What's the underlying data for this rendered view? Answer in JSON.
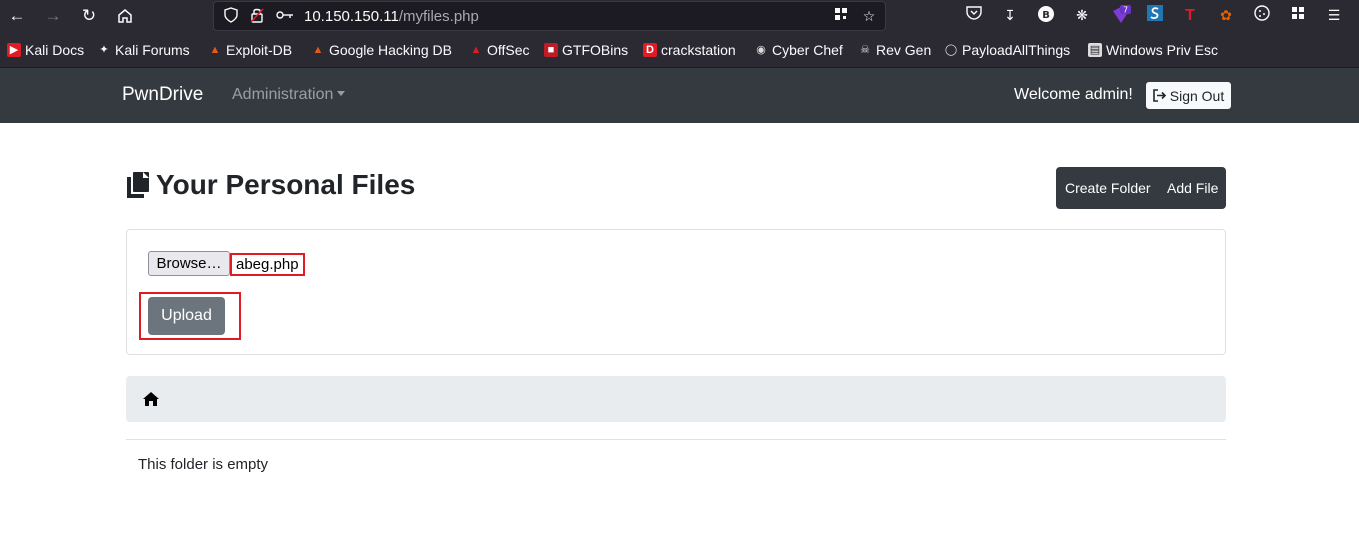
{
  "browser": {
    "url_host": "10.150.150.11",
    "url_path": "/myfiles.php",
    "extension_badge": "7"
  },
  "bookmarks": [
    {
      "label": "Kali Docs",
      "icon": "kali-docs-icon",
      "color": "#e01b24"
    },
    {
      "label": "Kali Forums",
      "icon": "kali-forums-icon",
      "color": "#ffffff"
    },
    {
      "label": "Exploit-DB",
      "icon": "exploit-db-icon",
      "color": "#e05a1b"
    },
    {
      "label": "Google Hacking DB",
      "icon": "ghdb-icon",
      "color": "#e05a1b"
    },
    {
      "label": "OffSec",
      "icon": "offsec-icon",
      "color": "#e01b24"
    },
    {
      "label": "GTFOBins",
      "icon": "gtfobins-icon",
      "color": "#c01c28"
    },
    {
      "label": "crackstation",
      "icon": "crackstation-icon",
      "color": "#e01b24"
    },
    {
      "label": "Cyber Chef",
      "icon": "cyber-chef-icon",
      "color": "#dddddd"
    },
    {
      "label": "Rev Gen",
      "icon": "skull-icon",
      "color": "#dddddd"
    },
    {
      "label": "PayloadAllThings",
      "icon": "github-icon",
      "color": "#dddddd"
    },
    {
      "label": "Windows Priv Esc",
      "icon": "windows-priv-esc-icon",
      "color": "#dddddd"
    }
  ],
  "navbar": {
    "brand": "PwnDrive",
    "admin_menu": "Administration",
    "welcome": "Welcome admin!",
    "sign_out": "Sign Out"
  },
  "main": {
    "title": "Your Personal Files",
    "create_folder": "Create Folder",
    "add_file": "Add File",
    "browse_label": "Browse…",
    "selected_file": "abeg.php",
    "upload_label": "Upload",
    "empty_message": "This folder is empty"
  },
  "colors": {
    "navbar_bg": "#343a40",
    "highlight": "#e01b24",
    "upload_btn": "#6c757d"
  }
}
